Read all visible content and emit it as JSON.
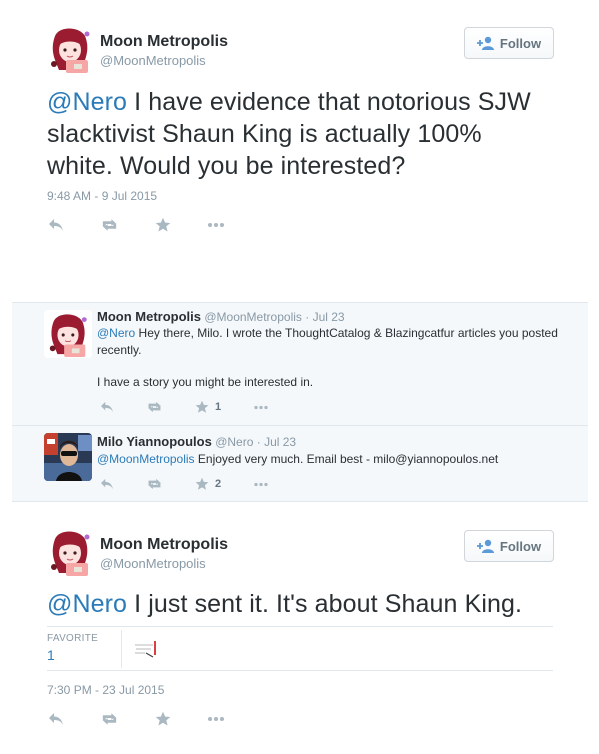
{
  "tweet1": {
    "display_name": "Moon Metropolis",
    "handle": "@MoonMetropolis",
    "follow_label": "Follow",
    "mention": "@Nero",
    "text": " I have evidence that notorious SJW slacktivist Shaun King is actually 100% white. Would you be interested?",
    "timestamp": "9:48 AM - 9 Jul 2015"
  },
  "conversation": {
    "reply1": {
      "display_name": "Moon Metropolis",
      "handle": "@MoonMetropolis",
      "date": "· Jul 23",
      "mention": "@Nero",
      "text": " Hey there, Milo. I wrote the ThoughtCatalog & Blazingcatfur articles you posted recently.",
      "text2": "I have a story you might be interested in.",
      "favorites": "1"
    },
    "reply2": {
      "display_name": "Milo Yiannopoulos",
      "handle": "@Nero",
      "date": "· Jul 23",
      "mention": "@MoonMetropolis",
      "text": " Enjoyed very much. Email best - milo@yiannopoulos.net",
      "favorites": "2"
    }
  },
  "tweet2": {
    "display_name": "Moon Metropolis",
    "handle": "@MoonMetropolis",
    "follow_label": "Follow",
    "mention": "@Nero",
    "text": " I just sent it.  It's about Shaun King.",
    "favorite_label": "FAVORITE",
    "favorite_count": "1",
    "timestamp": "7:30 PM - 23 Jul 2015"
  },
  "icons": {
    "reply": "reply-icon",
    "retweet": "retweet-icon",
    "favorite": "star-icon",
    "more": "more-icon",
    "follow": "add-user-icon"
  },
  "colors": {
    "link": "#2b7bb9",
    "muted": "#8899a6",
    "action": "#aab8c2",
    "conversation_bg": "#f5f8fa"
  }
}
